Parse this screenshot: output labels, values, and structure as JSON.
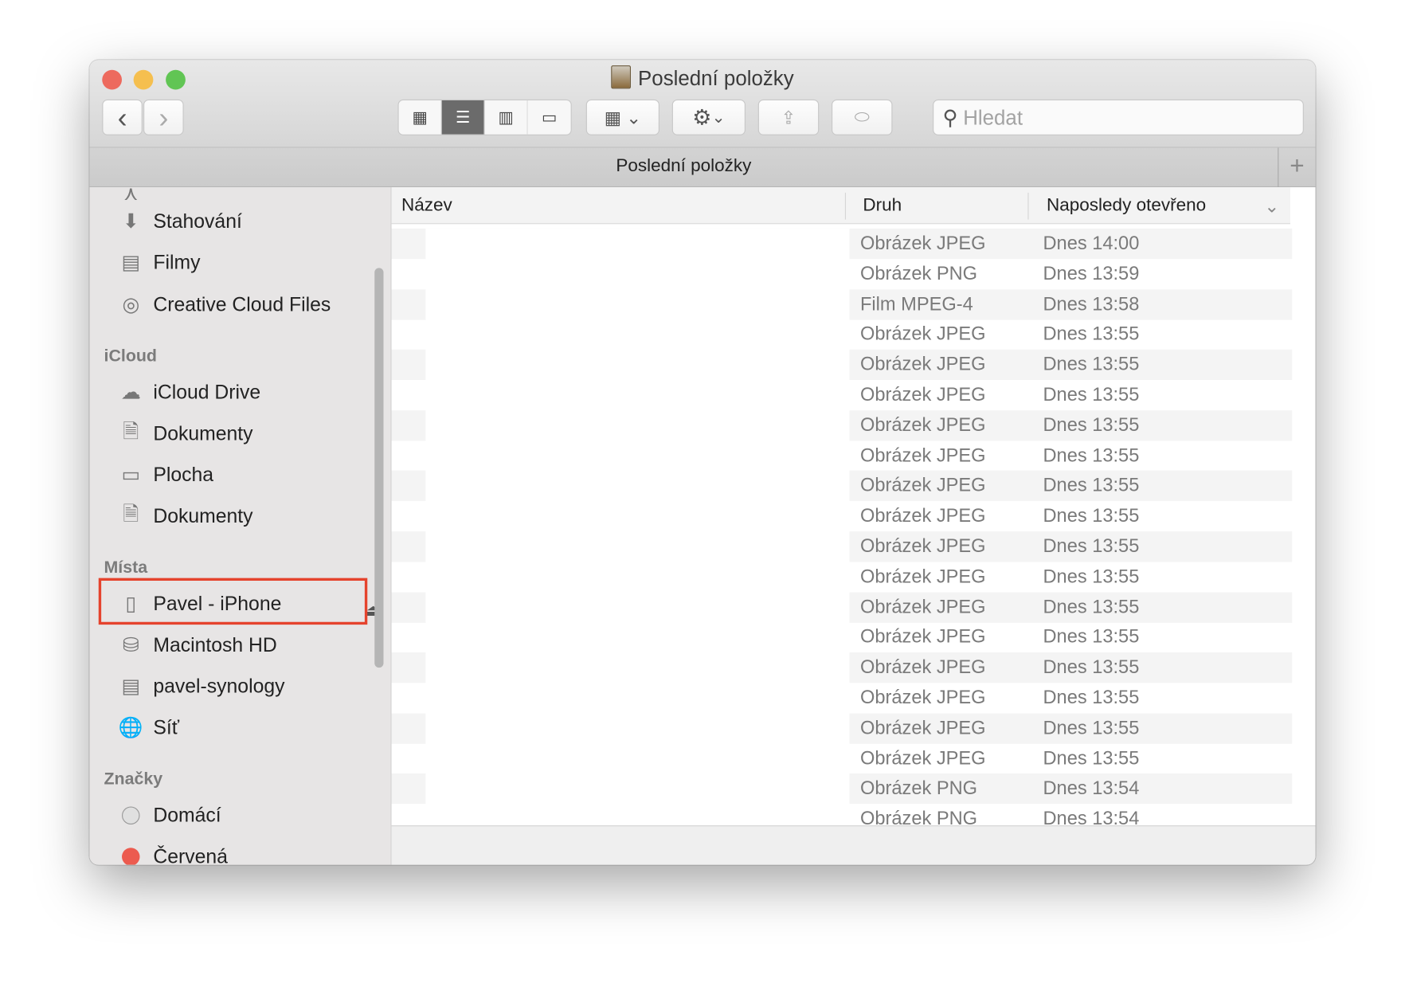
{
  "window": {
    "title": "Poslední položky",
    "tab_title": "Poslední položky"
  },
  "toolbar": {
    "search_placeholder": "Hledat",
    "back": "‹",
    "forward": "›",
    "new_tab": "+"
  },
  "sidebar": {
    "favorites": [
      {
        "label": "Stahování",
        "icon": "download-icon"
      },
      {
        "label": "Filmy",
        "icon": "film-icon"
      },
      {
        "label": "Creative Cloud Files",
        "icon": "creative-cloud-icon"
      }
    ],
    "icloud_header": "iCloud",
    "icloud": [
      {
        "label": "iCloud Drive",
        "icon": "cloud-icon"
      },
      {
        "label": "Dokumenty",
        "icon": "document-icon"
      },
      {
        "label": "Plocha",
        "icon": "desktop-icon"
      },
      {
        "label": "Dokumenty",
        "icon": "document-icon"
      }
    ],
    "places_header": "Místa",
    "places": [
      {
        "label": "Pavel - iPhone",
        "icon": "iphone-icon"
      },
      {
        "label": "Macintosh HD",
        "icon": "hard-drive-icon"
      },
      {
        "label": "pavel-synology",
        "icon": "nas-icon"
      },
      {
        "label": "Síť",
        "icon": "network-icon"
      }
    ],
    "tags_header": "Značky",
    "tags": [
      {
        "label": "Domácí",
        "color": "#e0e0e0"
      },
      {
        "label": "Červená",
        "color": "#ec5b4f"
      }
    ]
  },
  "list": {
    "columns": {
      "name": "Název",
      "kind": "Druh",
      "date": "Naposledy otevřeno"
    },
    "rows": [
      {
        "kind": "Obrázek JPEG",
        "date": "Dnes 14:00"
      },
      {
        "kind": "Obrázek PNG",
        "date": "Dnes 13:59"
      },
      {
        "kind": "Film MPEG-4",
        "date": "Dnes 13:58"
      },
      {
        "kind": "Obrázek JPEG",
        "date": "Dnes 13:55"
      },
      {
        "kind": "Obrázek JPEG",
        "date": "Dnes 13:55"
      },
      {
        "kind": "Obrázek JPEG",
        "date": "Dnes 13:55"
      },
      {
        "kind": "Obrázek JPEG",
        "date": "Dnes 13:55"
      },
      {
        "kind": "Obrázek JPEG",
        "date": "Dnes 13:55"
      },
      {
        "kind": "Obrázek JPEG",
        "date": "Dnes 13:55"
      },
      {
        "kind": "Obrázek JPEG",
        "date": "Dnes 13:55"
      },
      {
        "kind": "Obrázek JPEG",
        "date": "Dnes 13:55"
      },
      {
        "kind": "Obrázek JPEG",
        "date": "Dnes 13:55"
      },
      {
        "kind": "Obrázek JPEG",
        "date": "Dnes 13:55"
      },
      {
        "kind": "Obrázek JPEG",
        "date": "Dnes 13:55"
      },
      {
        "kind": "Obrázek JPEG",
        "date": "Dnes 13:55"
      },
      {
        "kind": "Obrázek JPEG",
        "date": "Dnes 13:55"
      },
      {
        "kind": "Obrázek JPEG",
        "date": "Dnes 13:55"
      },
      {
        "kind": "Obrázek JPEG",
        "date": "Dnes 13:55"
      },
      {
        "kind": "Obrázek PNG",
        "date": "Dnes 13:54"
      },
      {
        "kind": "Obrázek PNG",
        "date": "Dnes 13:54"
      }
    ]
  },
  "colors": {
    "highlight": "#e5432d",
    "close": "#ed6a5e",
    "minimize": "#f5bf4f",
    "zoom": "#61c554"
  }
}
